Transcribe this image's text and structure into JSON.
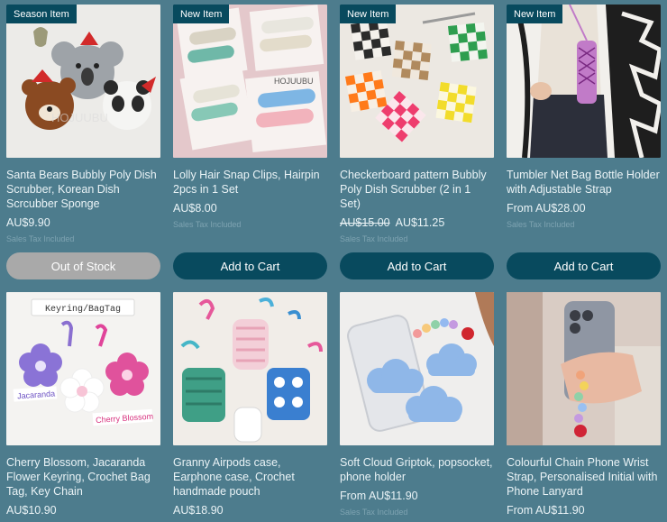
{
  "products": [
    {
      "ribbon": "Season Item",
      "title": "Santa Bears Bubbly Poly Dish Scrubber, Korean Dish Scrcubber Sponge",
      "price": "AU$9.90",
      "tax": "Sales Tax Included",
      "button": "Out of Stock"
    },
    {
      "ribbon": "New Item",
      "title": "Lolly Hair Snap Clips, Hairpin 2pcs in 1 Set",
      "price": "AU$8.00",
      "tax": "Sales Tax Included",
      "button": "Add to Cart"
    },
    {
      "ribbon": "New Item",
      "title": "Checkerboard pattern Bubbly Poly Dish Scrubber (2 in 1 Set)",
      "old_price": "AU$15.00",
      "price": "AU$11.25",
      "tax": "Sales Tax Included",
      "button": "Add to Cart"
    },
    {
      "ribbon": "New Item",
      "title": "Tumbler Net Bag Bottle Holder with Adjustable Strap",
      "price": "From AU$28.00",
      "tax": "Sales Tax Included",
      "button": "Add to Cart"
    },
    {
      "title": "Cherry Blossom, Jacaranda Flower Keyring, Crochet Bag Tag, Key Chain",
      "price": "AU$10.90"
    },
    {
      "title": "Granny Airpods case, Earphone case, Crochet handmade pouch",
      "price": "AU$18.90"
    },
    {
      "title": "Soft Cloud Griptok, popsocket, phone holder",
      "price": "From AU$11.90",
      "tax": "Sales Tax Included"
    },
    {
      "title": "Colourful Chain Phone Wrist Strap, Personalised Initial with Phone Lanyard",
      "price": "From AU$11.90"
    }
  ],
  "image_text": {
    "brand": "HOJUUBU",
    "keyring_banner": "Keyring/BagTag",
    "jacaranda": "Jacaranda",
    "cherry_blossom": "Cherry Blossom"
  },
  "colors": {
    "background": "#4d7c8d",
    "button": "#084a5e",
    "out_of_stock": "#a9a9a9"
  }
}
